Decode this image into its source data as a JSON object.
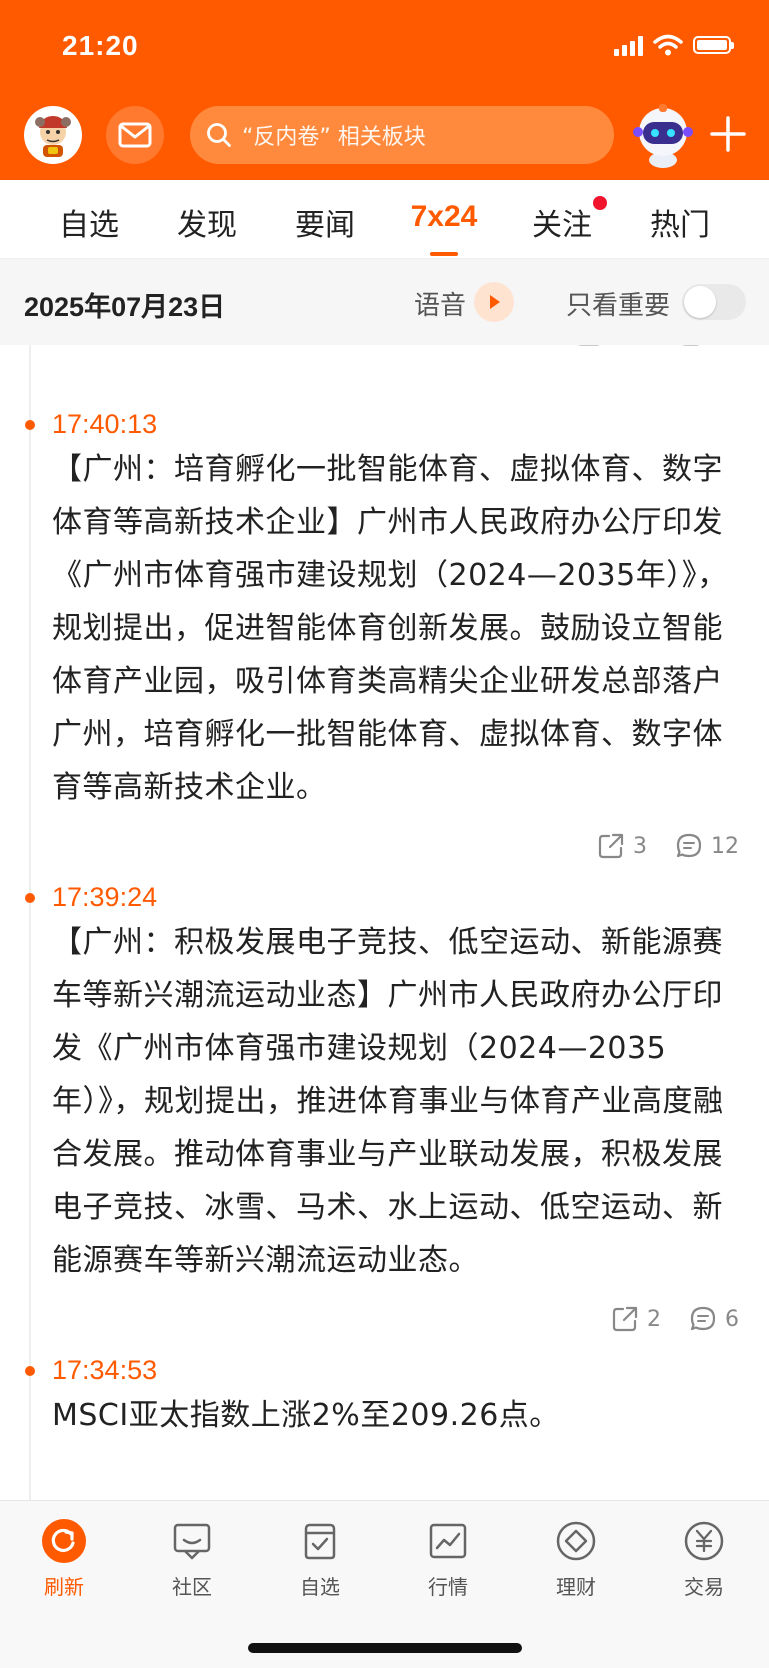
{
  "status_bar": {
    "time": "21:20"
  },
  "header": {
    "search_placeholder": "“反内卷” 相关板块"
  },
  "tabs": [
    {
      "label": "自选"
    },
    {
      "label": "发现"
    },
    {
      "label": "要闻"
    },
    {
      "label": "7x24",
      "active": true
    },
    {
      "label": "关注",
      "has_badge": true
    },
    {
      "label": "热门"
    }
  ],
  "date_bar": {
    "date": "2025年07月23日",
    "voice_label": "语音",
    "important_label": "只看重要",
    "important_only": false
  },
  "news": [
    {
      "time": "17:40:13",
      "text": "【广州：培育孵化一批智能体育、虚拟体育、数字体育等高新技术企业】广州市人民政府办公厅印发《广州市体育强市建设规划（2024—2035年）》，规划提出，促进智能体育创新发展。鼓励设立智能体育产业园，吸引体育类高精尖企业研发总部落户广州，培育孵化一批智能体育、虚拟体育、数字体育等高新技术企业。",
      "shares": "3",
      "comments": "12"
    },
    {
      "time": "17:39:24",
      "text": "【广州：积极发展电子竞技、低空运动、新能源赛车等新兴潮流运动业态】广州市人民政府办公厅印发《广州市体育强市建设规划（2024—2035年）》，规划提出，推进体育事业与体育产业高度融合发展。推动体育事业与产业联动发展，积极发展电子竞技、冰雪、马术、水上运动、低空运动、新能源赛车等新兴潮流运动业态。",
      "shares": "2",
      "comments": "6"
    },
    {
      "time": "17:34:53",
      "text": "MSCI亚太指数上涨2%至209.26点。"
    }
  ],
  "bottom_nav": [
    {
      "label": "刷新",
      "icon": "refresh-icon",
      "active": true
    },
    {
      "label": "社区",
      "icon": "community-icon"
    },
    {
      "label": "自选",
      "icon": "watchlist-icon"
    },
    {
      "label": "行情",
      "icon": "market-icon"
    },
    {
      "label": "理财",
      "icon": "wealth-icon"
    },
    {
      "label": "交易",
      "icon": "trade-icon"
    }
  ],
  "colors": {
    "brand": "#ff5a00",
    "badge": "#f0142d"
  }
}
